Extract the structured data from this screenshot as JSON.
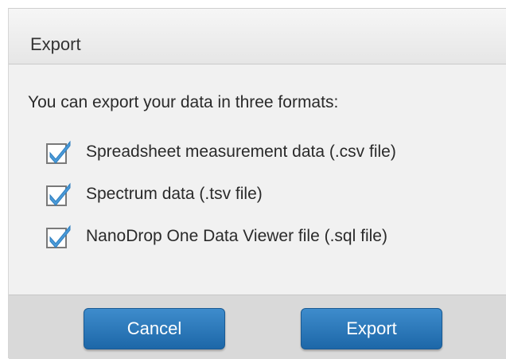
{
  "dialog": {
    "title": "Export",
    "intro": "You can export your data in three formats:",
    "options": [
      {
        "label": "Spreadsheet measurement data (.csv file)",
        "checked": true
      },
      {
        "label": "Spectrum data (.tsv file)",
        "checked": true
      },
      {
        "label": "NanoDrop One Data Viewer file (.sql file)",
        "checked": true
      }
    ],
    "buttons": {
      "cancel_label": "Cancel",
      "export_label": "Export"
    }
  },
  "colors": {
    "button": "#2a78bb",
    "checkmark": "#4a9ad8",
    "checkbox_border": "#7a7a7a"
  },
  "icons": {
    "checkbox": "checkbox-checked-icon"
  }
}
